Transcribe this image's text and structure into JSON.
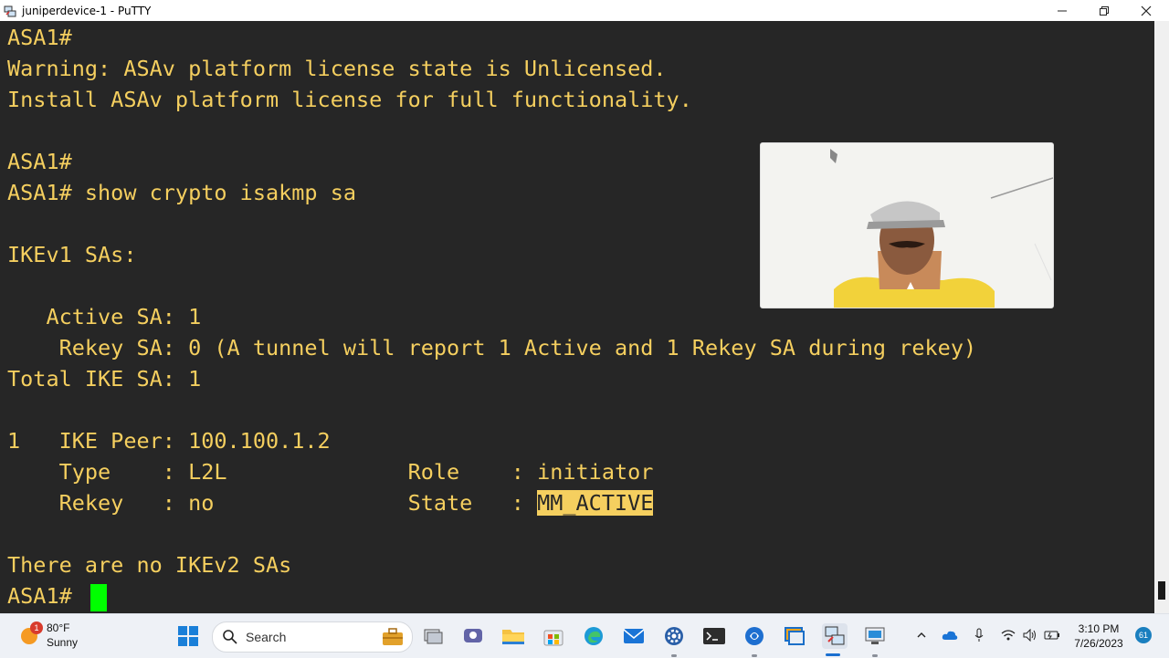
{
  "window": {
    "title": "juniperdevice-1 - PuTTY",
    "minimize_icon": "minimize-icon",
    "maximize_icon": "restore-icon",
    "close_icon": "close-icon"
  },
  "terminal": {
    "lines": [
      "ASA1#",
      "Warning: ASAv platform license state is Unlicensed.",
      "Install ASAv platform license for full functionality.",
      "",
      "ASA1#",
      "ASA1# show crypto isakmp sa",
      "",
      "IKEv1 SAs:",
      "",
      "   Active SA: 1",
      "    Rekey SA: 0 (A tunnel will report 1 Active and 1 Rekey SA during rekey)",
      "Total IKE SA: 1",
      "",
      "1   IKE Peer: 100.100.1.2",
      "    Type    : L2L              Role    : initiator",
      "    Rekey   : no               State   : ",
      "",
      "There are no IKEv2 SAs",
      "ASA1# "
    ],
    "highlight_text": "MM_ACTIVE",
    "text_color": "#f5cf5f",
    "background_color": "#262626",
    "cursor_color": "#00ff00"
  },
  "webcam": {
    "label": "webcam-overlay"
  },
  "taskbar": {
    "weather": {
      "badge": "1",
      "temp": "80°F",
      "condition": "Sunny"
    },
    "search_label": "Search",
    "apps": [
      "start",
      "file-explorer",
      "task-view",
      "teams",
      "folder",
      "store",
      "edge",
      "mail",
      "settings",
      "terminal",
      "browser",
      "app",
      "putty",
      "remote"
    ],
    "clock": {
      "time": "3:10 PM",
      "date": "7/26/2023"
    },
    "notification_count": "61"
  }
}
